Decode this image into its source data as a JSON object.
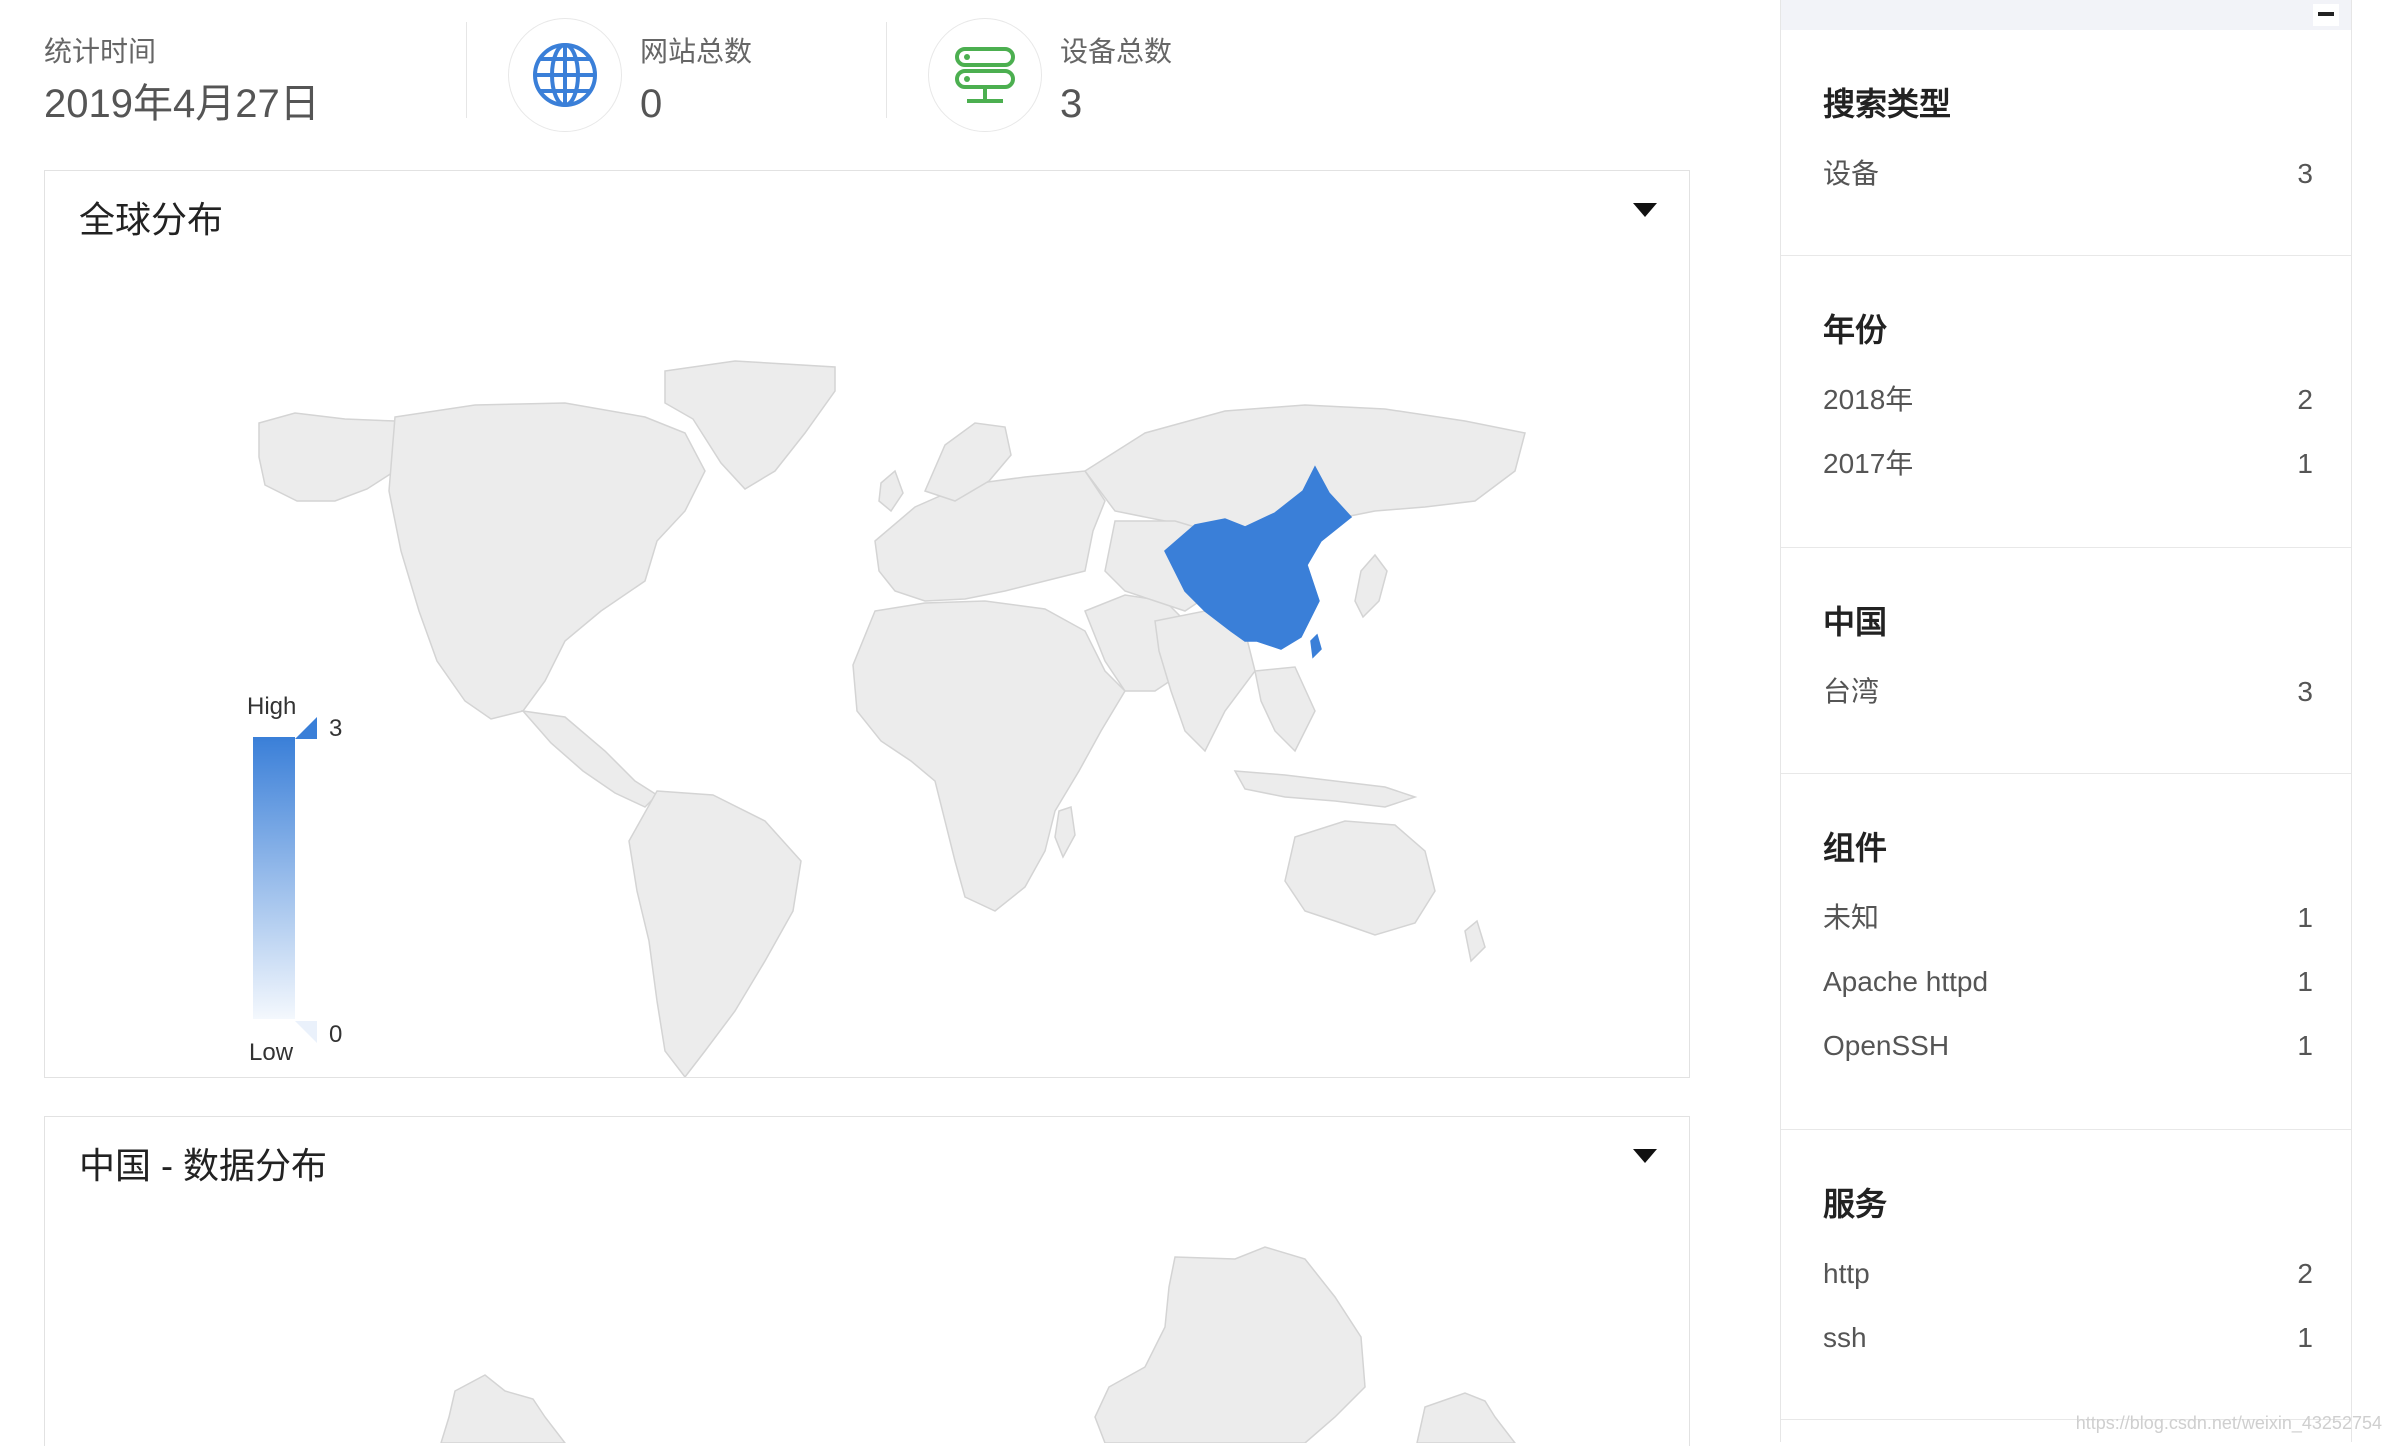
{
  "stats": {
    "time_label": "统计时间",
    "time_value": "2019年4月27日",
    "sites_label": "网站总数",
    "sites_value": "0",
    "devices_label": "设备总数",
    "devices_value": "3"
  },
  "icons": {
    "sites": "globe-icon",
    "devices": "server-icon"
  },
  "colors": {
    "accent": "#3a7fd8",
    "land": "#ececec",
    "devices_icon": "#4caf50"
  },
  "panels": {
    "global": {
      "title": "全球分布"
    },
    "china": {
      "title": "中国 - 数据分布"
    }
  },
  "legend": {
    "high": "High",
    "low": "Low",
    "max": "3",
    "min": "0"
  },
  "chart_data": {
    "type": "choropleth",
    "highlighted_regions": [
      {
        "name": "China",
        "value": 3
      }
    ],
    "range": [
      0,
      3
    ]
  },
  "sidebar": {
    "facets": [
      {
        "title": "搜索类型",
        "items": [
          {
            "name": "设备",
            "count": "3"
          }
        ]
      },
      {
        "title": "年份",
        "items": [
          {
            "name": "2018年",
            "count": "2"
          },
          {
            "name": "2017年",
            "count": "1"
          }
        ]
      },
      {
        "title": "中国",
        "items": [
          {
            "name": "台湾",
            "count": "3"
          }
        ]
      },
      {
        "title": "组件",
        "items": [
          {
            "name": "未知",
            "count": "1"
          },
          {
            "name": "Apache httpd",
            "count": "1"
          },
          {
            "name": "OpenSSH",
            "count": "1"
          }
        ]
      },
      {
        "title": "服务",
        "items": [
          {
            "name": "http",
            "count": "2"
          },
          {
            "name": "ssh",
            "count": "1"
          }
        ]
      }
    ]
  },
  "watermark": "https://blog.csdn.net/weixin_43252754"
}
